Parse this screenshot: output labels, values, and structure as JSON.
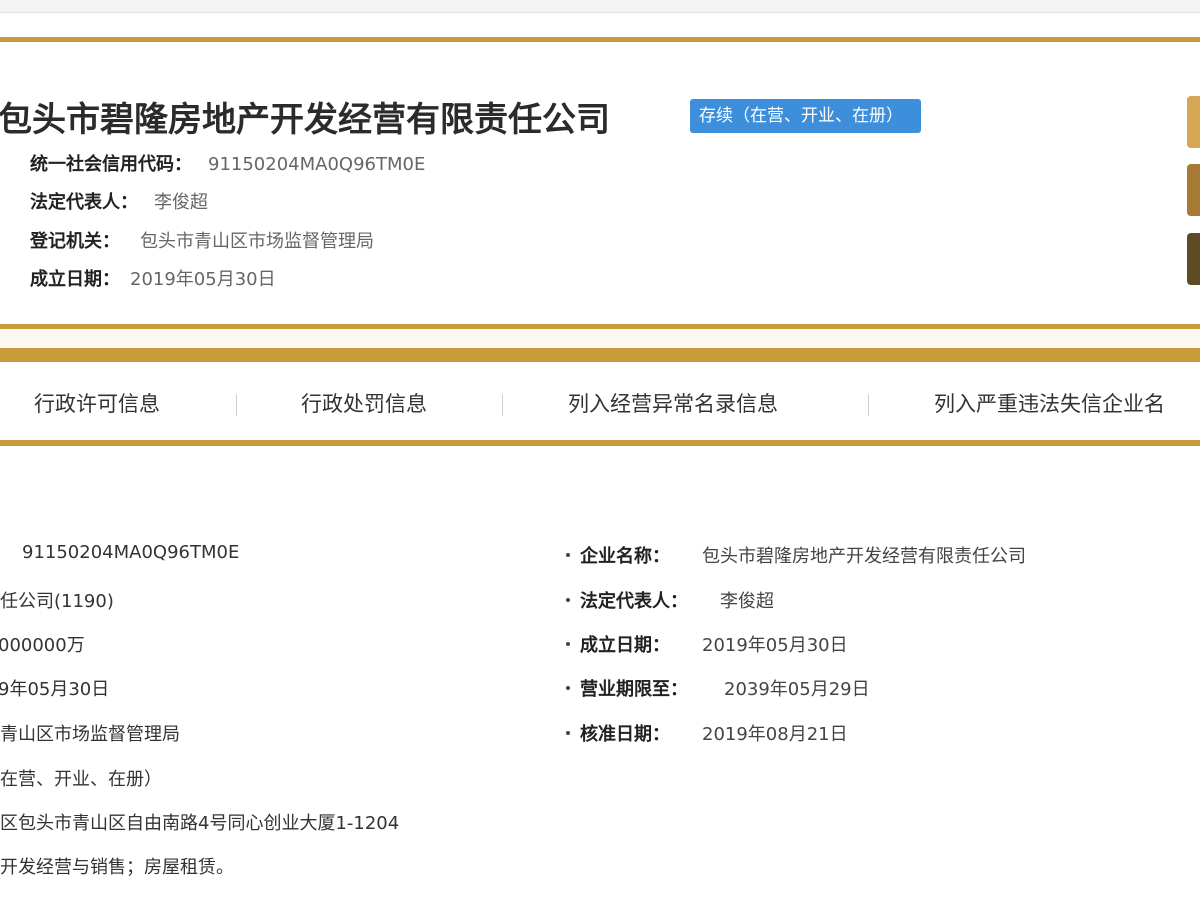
{
  "company": {
    "name": "包头市碧隆房地产开发经营有限责任公司",
    "status": "存续（在营、开业、在册）",
    "info": [
      {
        "label": "统一社会信用代码：",
        "value": "91150204MA0Q96TM0E"
      },
      {
        "label": "法定代表人：",
        "value": "李俊超"
      },
      {
        "label": "登记机关：",
        "value": "包头市青山区市场监督管理局"
      },
      {
        "label": "成立日期：",
        "value": "2019年05月30日"
      }
    ]
  },
  "tabs": [
    {
      "label": "行政许可信息"
    },
    {
      "label": "行政处罚信息"
    },
    {
      "label": "列入经营异常名录信息"
    },
    {
      "label": "列入严重违法失信企业名"
    }
  ],
  "details": {
    "left": [
      {
        "value": "91150204MA0Q96TM0E"
      },
      {
        "value": "任公司(1190)"
      },
      {
        "value": "000000万"
      },
      {
        "value": "9年05月30日"
      },
      {
        "value": "青山区市场监督管理局"
      },
      {
        "value": "在营、开业、在册）"
      },
      {
        "value": "区包头市青山区自由南路4号同心创业大厦1-1204"
      },
      {
        "value": "开发经营与销售；房屋租赁。"
      }
    ],
    "right": [
      {
        "label": "企业名称：",
        "value": "包头市碧隆房地产开发经营有限责任公司"
      },
      {
        "label": "法定代表人：",
        "value": "李俊超"
      },
      {
        "label": "成立日期：",
        "value": "2019年05月30日"
      },
      {
        "label": "营业期限至：",
        "value": "2039年05月29日"
      },
      {
        "label": "核准日期：",
        "value": "2019年08月21日"
      }
    ]
  },
  "colors": {
    "accent_gold": "#c99a3a",
    "status_blue": "#3e8fdb",
    "side_button_1": "#d6a654",
    "side_button_2": "#a77a35",
    "side_button_3": "#5e4a24"
  }
}
